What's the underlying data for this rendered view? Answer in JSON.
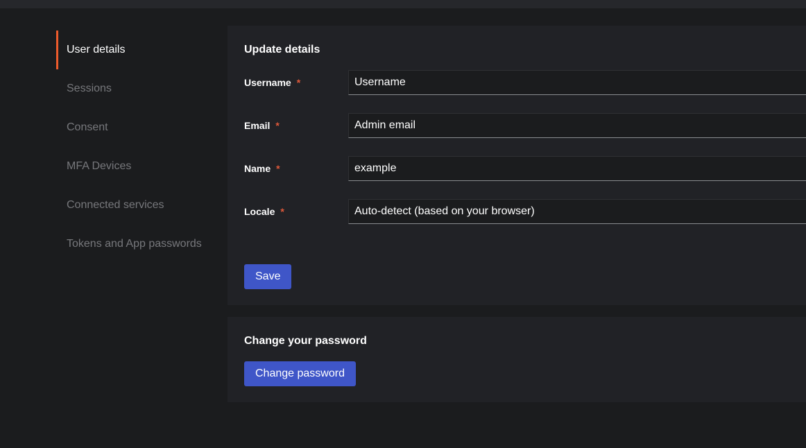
{
  "sidebar": {
    "items": [
      {
        "label": "User details",
        "active": true
      },
      {
        "label": "Sessions"
      },
      {
        "label": "Consent"
      },
      {
        "label": "MFA Devices"
      },
      {
        "label": "Connected services"
      },
      {
        "label": "Tokens and App passwords"
      }
    ]
  },
  "update_details": {
    "title": "Update details",
    "required_marker": "*",
    "fields": {
      "username": {
        "label": "Username",
        "value": "Username"
      },
      "email": {
        "label": "Email",
        "value": "Admin email"
      },
      "name": {
        "label": "Name",
        "value": "example"
      },
      "locale": {
        "label": "Locale",
        "value": "Auto-detect (based on your browser)"
      }
    },
    "save_label": "Save"
  },
  "change_password": {
    "title": "Change your password",
    "button_label": "Change password"
  },
  "colors": {
    "accent": "#ee5b2c",
    "required": "#e0593a",
    "primary_button": "#3f56c8",
    "background": "#1b1c1e",
    "card": "#212226"
  }
}
